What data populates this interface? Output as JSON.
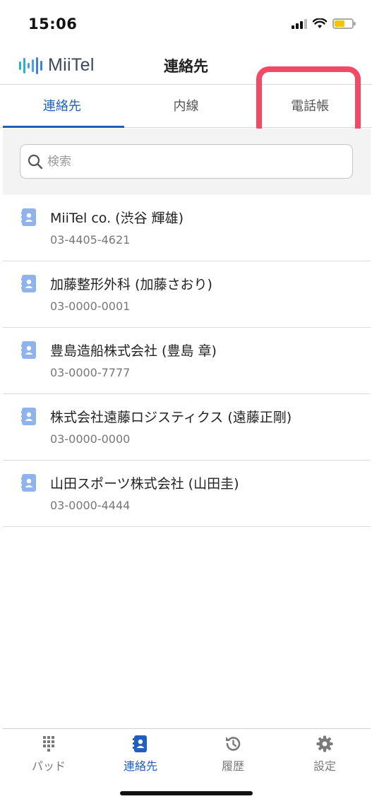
{
  "status_bar": {
    "time": "15:06"
  },
  "header": {
    "logo_text": "MiiTel",
    "title": "連絡先"
  },
  "tabs": [
    {
      "label": "連絡先",
      "active": true
    },
    {
      "label": "内線",
      "active": false
    },
    {
      "label": "電話帳",
      "active": false
    }
  ],
  "search": {
    "placeholder": "検索",
    "value": ""
  },
  "contacts": [
    {
      "name": "MiiTel co. (渋谷 輝雄)",
      "phone": "03-4405-4621"
    },
    {
      "name": "加藤整形外科 (加藤さおり)",
      "phone": "03-0000-0001"
    },
    {
      "name": "豊島造船株式会社 (豊島 章)",
      "phone": "03-0000-7777"
    },
    {
      "name": "株式会社遠藤ロジスティクス (遠藤正剛)",
      "phone": "03-0000-0000"
    },
    {
      "name": "山田スポーツ株式会社 (山田圭)",
      "phone": "03-0000-4444"
    }
  ],
  "bottom_nav": [
    {
      "label": "パッド",
      "icon": "dialpad-icon",
      "active": false
    },
    {
      "label": "連絡先",
      "icon": "contacts-icon",
      "active": true
    },
    {
      "label": "履歴",
      "icon": "history-icon",
      "active": false
    },
    {
      "label": "設定",
      "icon": "gear-icon",
      "active": false
    }
  ],
  "colors": {
    "accent": "#1f5fbf",
    "highlight": "#f04a66",
    "logo": "#2ab3c8",
    "contact_icon": "#8fb4ec"
  }
}
